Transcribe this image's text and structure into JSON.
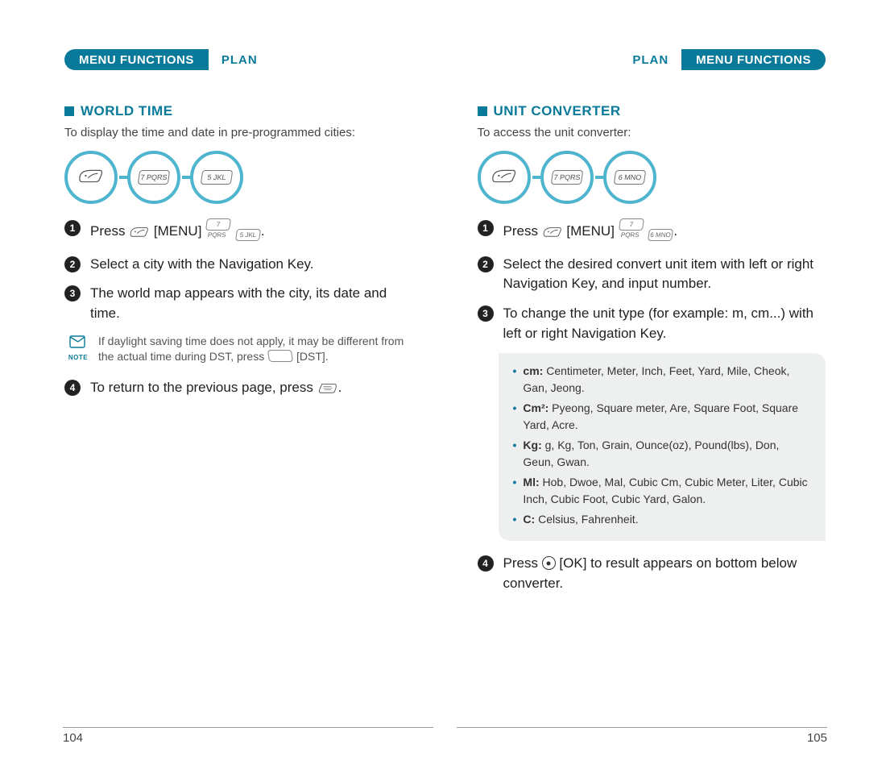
{
  "header": {
    "main": "MENU FUNCTIONS",
    "sub": "PLAN"
  },
  "left": {
    "title": "WORLD TIME",
    "intro": "To display the time and date in pre-programmed cities:",
    "keyseq": [
      "softkey",
      "7 PQRS",
      "5 JKL"
    ],
    "steps": {
      "s1a": "Press ",
      "s1b": " [MENU] ",
      "s2": "Select a city with the Navigation Key.",
      "s3": "The world map appears with the city, its date and time.",
      "s4a": "To return to the previous page, press ",
      "s4b": "."
    },
    "note": {
      "label": "NOTE",
      "text_a": "If daylight saving time does not apply, it may be different from the actual time during DST, press ",
      "text_b": " [DST]."
    },
    "page_num": "104"
  },
  "right": {
    "title": "UNIT CONVERTER",
    "intro": "To access the unit converter:",
    "keyseq": [
      "softkey",
      "7 PQRS",
      "6 MNO"
    ],
    "steps": {
      "s1a": "Press ",
      "s1b": " [MENU] ",
      "s2": "Select the desired convert unit item with left or right Navigation Key, and input number.",
      "s3": "To change the unit type (for example: m, cm...) with left or right Navigation Key.",
      "s4a": "Press ",
      "s4b": " [OK] to result appears on bottom below converter."
    },
    "info": {
      "cm_label": "cm:",
      "cm": " Centimeter, Meter, Inch, Feet, Yard, Mile, Cheok, Gan, Jeong.",
      "cm2_label": "Cm²:",
      "cm2": " Pyeong, Square meter, Are, Square Foot, Square Yard, Acre.",
      "kg_label": "Kg:",
      "kg": " g, Kg, Ton, Grain, Ounce(oz), Pound(lbs), Don, Geun, Gwan.",
      "ml_label": "Ml:",
      "ml": " Hob, Dwoe, Mal, Cubic Cm, Cubic Meter, Liter, Cubic Inch, Cubic Foot, Cubic Yard, Galon.",
      "c_label": "C:",
      "c": " Celsius, Fahrenheit."
    },
    "page_num": "105"
  }
}
